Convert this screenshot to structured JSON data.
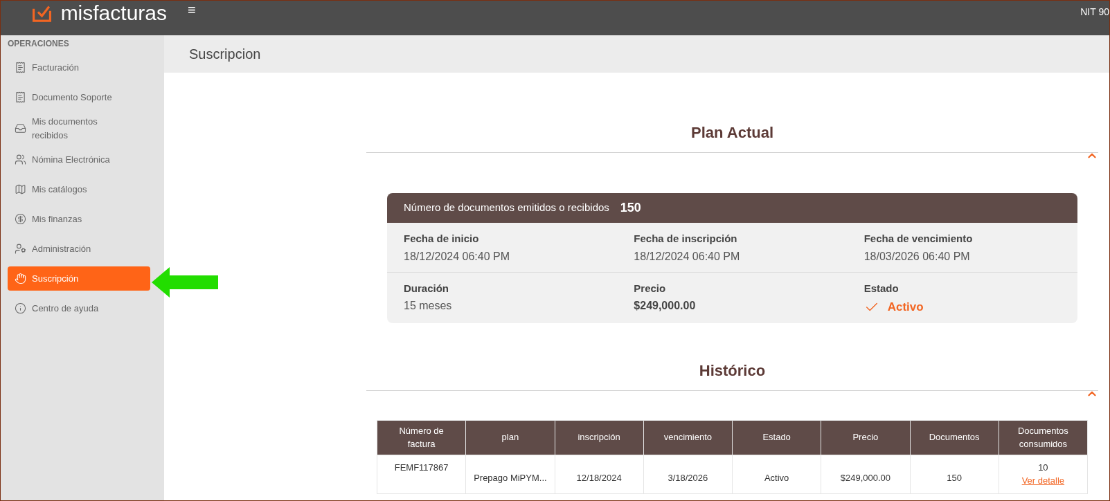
{
  "header": {
    "logo": "misfacturas",
    "menu_glyph": "≡",
    "account": "NIT 90"
  },
  "sidebar": {
    "section": "OPERACIONES",
    "items": [
      {
        "label": "Facturación",
        "selected": false
      },
      {
        "label": "Documento Soporte",
        "selected": false
      },
      {
        "label": "Mis documentos recibidos",
        "selected": false
      },
      {
        "label": "Nómina Electrónica",
        "selected": false
      },
      {
        "label": "Mis catálogos",
        "selected": false
      },
      {
        "label": "Mis finanzas",
        "selected": false
      },
      {
        "label": "Administración",
        "selected": false
      },
      {
        "label": "Suscripción",
        "selected": true
      },
      {
        "label": "Centro de ayuda",
        "selected": false
      }
    ]
  },
  "page_title": "Suscripcion",
  "plan": {
    "heading": "Plan Actual",
    "expanded": true,
    "count_label": "Número de documentos emitidos o recibidos",
    "count": "150",
    "fields": [
      {
        "label": "Fecha de inicio",
        "value": "18/12/2024 06:40 PM",
        "kind": "text"
      },
      {
        "label": "Fecha de inscripción",
        "value": "18/12/2024 06:40 PM",
        "kind": "text"
      },
      {
        "label": "Fecha de vencimiento",
        "value": "18/03/2026 06:40 PM",
        "kind": "text"
      },
      {
        "label": "Duración",
        "value": "15 meses",
        "kind": "text"
      },
      {
        "label": "Precio",
        "value": "$249,000.00",
        "kind": "bold"
      },
      {
        "label": "Estado",
        "value": "Activo",
        "kind": "status"
      }
    ]
  },
  "history": {
    "heading": "Histórico",
    "expanded": true,
    "table": {
      "columns": [
        "Número de factura",
        "plan",
        "inscripción",
        "vencimiento",
        "Estado",
        "Precio",
        "Documentos",
        "Documentos consumidos"
      ],
      "rows": [
        {
          "cells": [
            "FEMF117867",
            "Prepago MiPYM...",
            "12/18/2024",
            "3/18/2026",
            "Activo",
            "$249,000.00",
            "150",
            "10"
          ],
          "link": "Ver detalle"
        }
      ]
    }
  }
}
